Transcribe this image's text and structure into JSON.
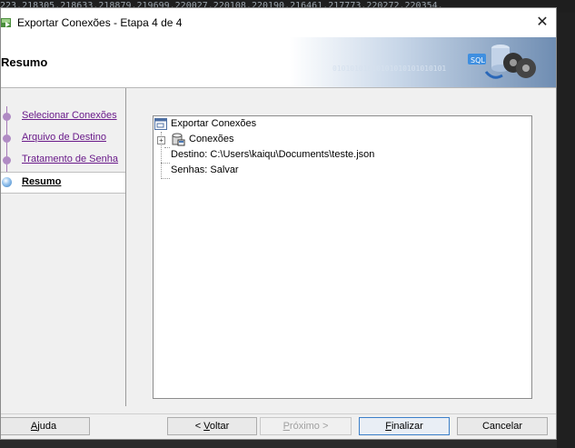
{
  "background_text": "223.218305.218633.218879.219699.220027.220108.220190.216461.217773.220272.220354.",
  "window": {
    "title": "Exportar Conexões - Etapa 4 de 4",
    "close_label": "✕"
  },
  "header": {
    "title": "Resumo",
    "binary": "01010101010101010101010101"
  },
  "steps": [
    {
      "label": "Selecionar Conexões",
      "state": "visited"
    },
    {
      "label": "Arquivo de Destino",
      "state": "visited"
    },
    {
      "label": "Tratamento de Senha",
      "state": "visited"
    },
    {
      "label": "Resumo",
      "state": "current"
    }
  ],
  "tree": {
    "root": "Exportar Conexões",
    "items": [
      {
        "label": "Conexões",
        "expandable": true
      },
      {
        "label": "Destino: C:\\Users\\kaiqu\\Documents\\teste.json",
        "expandable": false
      },
      {
        "label": "Senhas: Salvar",
        "expandable": false
      }
    ]
  },
  "buttons": {
    "help": {
      "mnemonic": "A",
      "rest": "juda"
    },
    "back": {
      "prefix": "< ",
      "mnemonic": "V",
      "rest": "oltar"
    },
    "next": {
      "mnemonic": "P",
      "rest": "róximo >",
      "disabled": true
    },
    "finish": {
      "mnemonic": "F",
      "rest": "inalizar"
    },
    "cancel": {
      "label": "Cancelar"
    }
  },
  "colors": {
    "accent": "#3c7fc8",
    "link_visited": "#6a1b8a",
    "step_dot": "#b08bc4"
  }
}
